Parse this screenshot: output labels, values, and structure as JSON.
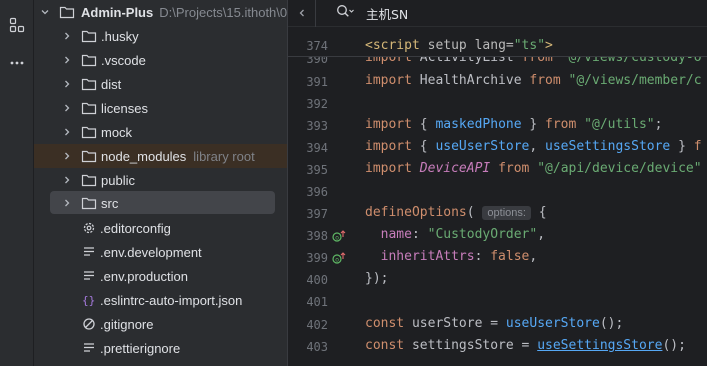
{
  "activity_bar": {
    "icons": [
      "structure-icon",
      "more-icon"
    ]
  },
  "project": {
    "root_name": "Admin-Plus",
    "root_path": "D:\\Projects\\15.ithoth\\0",
    "items": [
      {
        "label": ".husky",
        "type": "folder"
      },
      {
        "label": ".vscode",
        "type": "folder"
      },
      {
        "label": "dist",
        "type": "folder"
      },
      {
        "label": "licenses",
        "type": "folder"
      },
      {
        "label": "mock",
        "type": "folder"
      },
      {
        "label": "node_modules",
        "type": "folder",
        "hint": "library root"
      },
      {
        "label": "public",
        "type": "folder"
      },
      {
        "label": "src",
        "type": "folder"
      },
      {
        "label": ".editorconfig",
        "type": "file"
      },
      {
        "label": ".env.development",
        "type": "file"
      },
      {
        "label": ".env.production",
        "type": "file"
      },
      {
        "label": ".eslintrc-auto-import.json",
        "type": "file"
      },
      {
        "label": ".gitignore",
        "type": "file"
      },
      {
        "label": ".prettierignore",
        "type": "file"
      }
    ]
  },
  "editor": {
    "search_text": "主机SN",
    "sticky_line_number": "374",
    "sticky_code": {
      "tag_open": "<",
      "tag_name": "script",
      "attr1": " setup",
      "attr2": " lang",
      "eq": "=",
      "val": "\"ts\"",
      "tag_close": ">"
    },
    "lines": [
      {
        "n": "390",
        "t": "import ActivityList from \"@/views/custody-o"
      },
      {
        "n": "391",
        "t": "import HealthArchive from \"@/views/member/c"
      },
      {
        "n": "392",
        "t": ""
      },
      {
        "n": "393",
        "t": "import { maskedPhone } from \"@/utils\";"
      },
      {
        "n": "394",
        "t": "import { useUserStore, useSettingsStore } f"
      },
      {
        "n": "395",
        "t": "import DeviceAPI from \"@/api/device/device\""
      },
      {
        "n": "396",
        "t": ""
      },
      {
        "n": "397",
        "t": "defineOptions( options: {"
      },
      {
        "n": "398",
        "t": "  name: \"CustodyOrder\","
      },
      {
        "n": "399",
        "t": "  inheritAttrs: false,"
      },
      {
        "n": "400",
        "t": "});"
      },
      {
        "n": "401",
        "t": ""
      },
      {
        "n": "402",
        "t": "const userStore = useUserStore();"
      },
      {
        "n": "403",
        "t": "const settingsStore = useSettingsStore();"
      }
    ],
    "tokens": {
      "l390": {
        "kw": "import",
        "a": " ActivityList ",
        "from": "from",
        "s": " \"@/views/custody-o"
      },
      "l391": {
        "kw": "import",
        "a": " HealthArchive ",
        "from": "from",
        "s": " \"@/views/member/c"
      },
      "l393": {
        "kw": "import",
        "a": " { ",
        "f": "maskedPhone",
        "b": " } ",
        "from": "from",
        "s": " \"@/utils\"",
        "e": ";"
      },
      "l394": {
        "kw": "import",
        "a": " { ",
        "f1": "useUserStore",
        "c": ", ",
        "f2": "useSettingsStore",
        "b": " } ",
        "tail": "f"
      },
      "l395": {
        "kw": "import",
        "a": " ",
        "i": "DeviceAPI",
        "b": " ",
        "from": "from",
        "s": " \"@/api/device/device\""
      },
      "l397": {
        "fn": "defineOptions",
        "p": "(",
        "hint": "options:",
        "b": " {"
      },
      "l398": {
        "pre": "  ",
        "prop": "name",
        "c": ": ",
        "s": "\"CustodyOrder\"",
        "e": ","
      },
      "l399": {
        "pre": "  ",
        "prop": "inheritAttrs",
        "c": ": ",
        "kw": "false",
        "e": ","
      },
      "l400": {
        "t": "});"
      },
      "l402": {
        "kw": "const",
        "a": " userStore = ",
        "fn": "useUserStore",
        "e": "();"
      },
      "l403": {
        "kw": "const",
        "a": " settingsStore = ",
        "fn": "useSettingsStore",
        "e": "();"
      }
    }
  }
}
